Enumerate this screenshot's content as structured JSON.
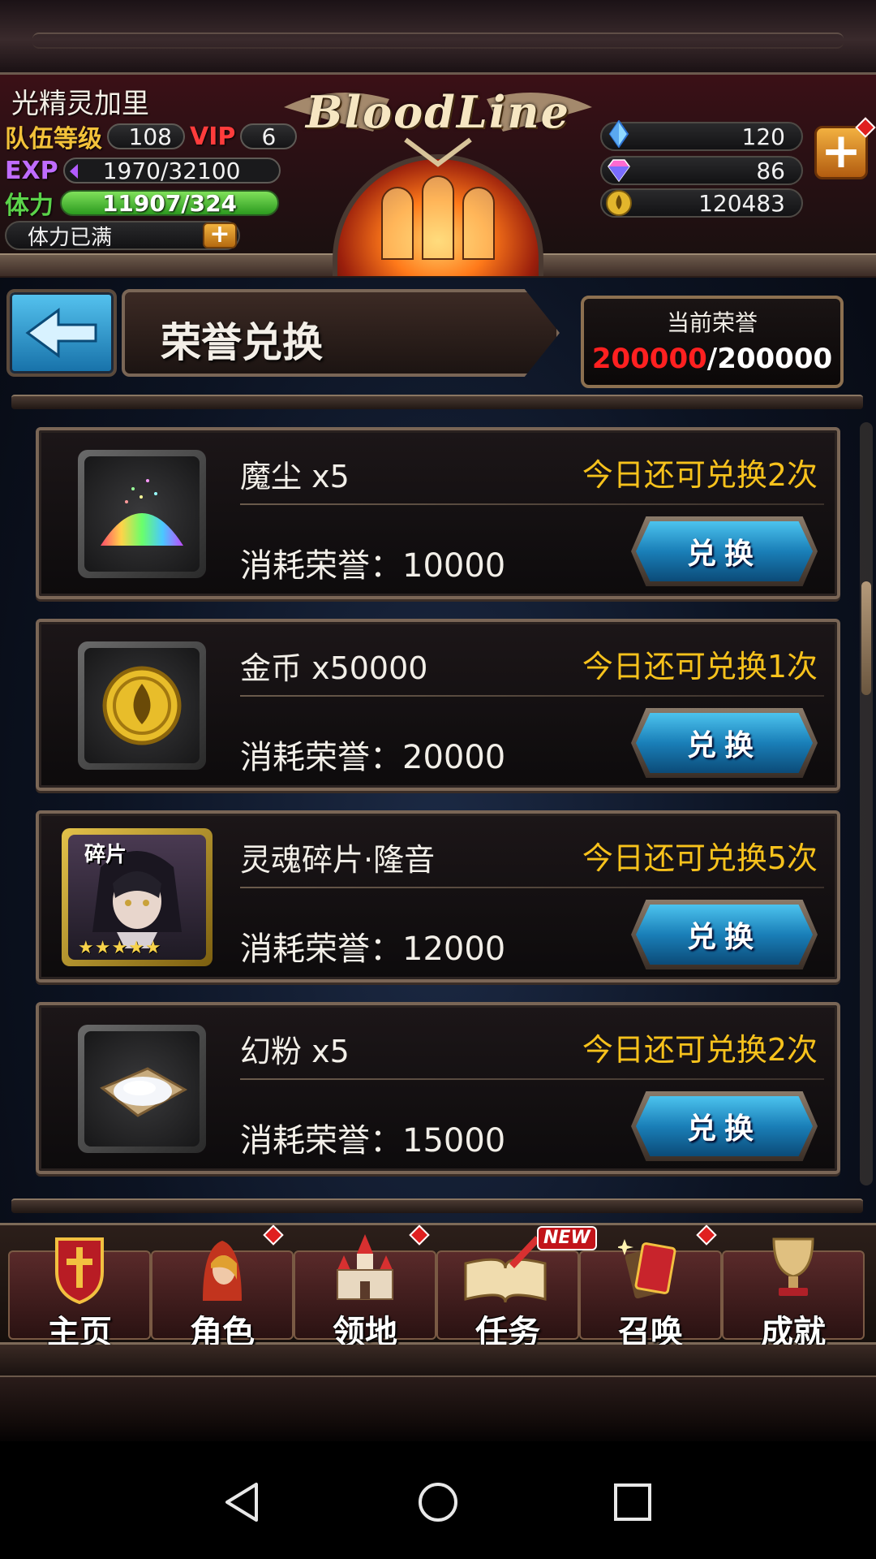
{
  "header": {
    "player_name": "光精灵加里",
    "level_label": "队伍等级",
    "level_value": "108",
    "vip_label": "VIP",
    "vip_value": "6",
    "exp_label": "EXP",
    "exp_value": "1970/32100",
    "stamina_label": "体力",
    "stamina_value": "11907/324",
    "stamina_status": "体力已满",
    "logo_text": "BloodLine",
    "currencies": [
      {
        "icon": "blue-crystal-icon",
        "value": "120"
      },
      {
        "icon": "rainbow-gem-icon",
        "value": "86"
      },
      {
        "icon": "gold-coin-icon",
        "value": "120483"
      }
    ]
  },
  "titlebar": {
    "title": "荣誉兑换",
    "honor_label": "当前荣誉",
    "honor_current": "200000",
    "honor_separator": "/",
    "honor_max": "200000"
  },
  "items": [
    {
      "name": "魔尘  x5",
      "limit": "今日还可兑换2次",
      "cost": "消耗荣誉：10000",
      "button": "兑换",
      "icon": "magic-dust-icon"
    },
    {
      "name": "金币  x50000",
      "limit": "今日还可兑换1次",
      "cost": "消耗荣誉：20000",
      "button": "兑换",
      "icon": "gold-coin-icon"
    },
    {
      "name": "灵魂碎片·隆音",
      "limit": "今日还可兑换5次",
      "cost": "消耗荣誉：12000",
      "button": "兑换",
      "icon": "soul-fragment-portrait",
      "badge": "碎片",
      "stars": "★★★★★"
    },
    {
      "name": "幻粉  x5",
      "limit": "今日还可兑换2次",
      "cost": "消耗荣誉：15000",
      "button": "兑换",
      "icon": "illusion-powder-icon"
    }
  ],
  "nav": [
    {
      "label": "主页",
      "icon": "home-shield-icon"
    },
    {
      "label": "角色",
      "icon": "character-icon"
    },
    {
      "label": "领地",
      "icon": "castle-icon"
    },
    {
      "label": "任务",
      "icon": "quest-book-icon",
      "badge": "NEW"
    },
    {
      "label": "召唤",
      "icon": "summon-cards-icon"
    },
    {
      "label": "成就",
      "icon": "trophy-icon"
    }
  ],
  "colors": {
    "honor_current": "#ff2020",
    "limit_text": "#f7c21c",
    "button_blue": "#1a7fb8"
  }
}
